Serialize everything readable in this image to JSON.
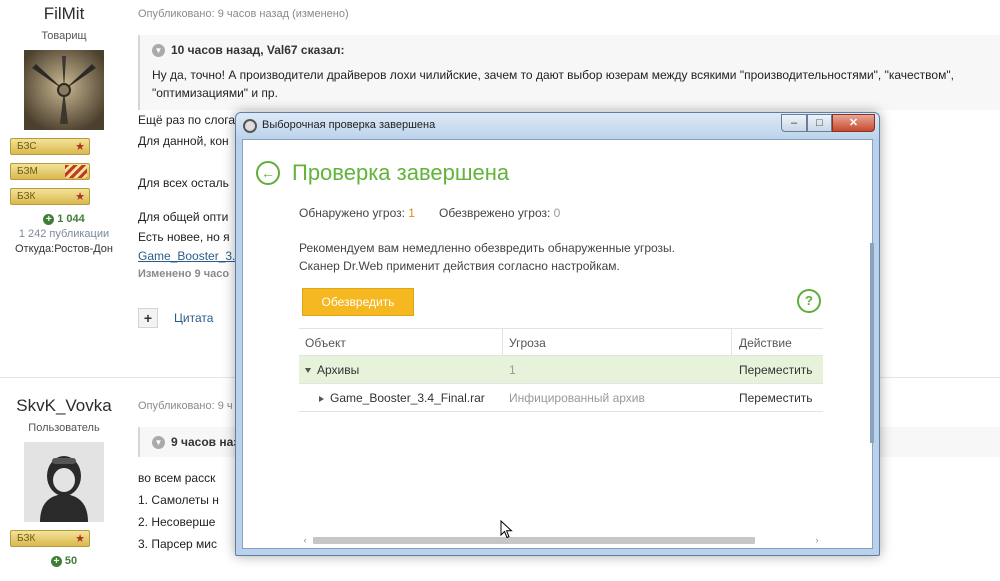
{
  "post1": {
    "author": {
      "name": "FilMit",
      "rank": "Товарищ",
      "badges": [
        {
          "label": "БЗС",
          "decoration": "star"
        },
        {
          "label": "БЗМ",
          "decoration": "stripes"
        },
        {
          "label": "БЗК",
          "decoration": "star"
        }
      ],
      "reputation": "1 044",
      "posts": "1 242 публикации",
      "location": "Откуда:Ростов-Дон"
    },
    "meta": "Опубликовано: 9 часов назад (изменено)",
    "quote": {
      "header": "10 часов назад, Val67 сказал:",
      "line1": "Ну да, точно! А производители драйверов лохи чилийские, зачем то дают выбор юзерам между всякими \"производительностями\", \"качеством\",",
      "line2": "\"оптимизациями\" и пр."
    },
    "lines": [
      "Ещё раз по слога",
      "Для данной, кон"
    ],
    "line3": "Для всех осталь",
    "line4": "Для общей опти",
    "line5": "Есть новее, но я",
    "link": "Game_Booster_3.",
    "edited": "Изменено 9 часо",
    "actions": {
      "plus": "+",
      "quote": "Цитата"
    }
  },
  "post2": {
    "author": {
      "name": "SkvK_Vovka",
      "rank": "Пользователь",
      "badges": [
        {
          "label": "БЗК",
          "decoration": "star"
        }
      ],
      "reputation": "50"
    },
    "meta": "Опубликовано: 9 ч",
    "quote": {
      "header": "9 часов наз"
    },
    "lines": [
      "во всем расск",
      "1. Самолеты н",
      "2. Несоверше",
      "3. Парсер мис"
    ]
  },
  "dialog": {
    "title": "Выборочная проверка завершена",
    "controls": {
      "minimize": "–",
      "maximize": "□",
      "close": "✕"
    },
    "heading": "Проверка завершена",
    "detected_label": "Обнаружено угроз:",
    "detected_value": "1",
    "neutralized_label": "Обезврежено угроз:",
    "neutralized_value": "0",
    "recommend_line1": "Рекомендуем вам немедленно обезвредить обнаруженные угрозы.",
    "recommend_line2": "Сканер Dr.Web применит действия согласно настройкам.",
    "neutralize_button": "Обезвредить",
    "help": "?",
    "table": {
      "columns": [
        "Объект",
        "Угроза",
        "Действие"
      ],
      "rows": [
        {
          "object": "Архивы",
          "threat": "1",
          "action": "Переместить",
          "expanded": true
        },
        {
          "object": "Game_Booster_3.4_Final.rar",
          "threat": "Инфицированный архив",
          "action": "Переместить",
          "expanded": false
        }
      ]
    }
  },
  "colors": {
    "accent_green": "#61b33a",
    "button_orange": "#f5b820",
    "threat_count_orange": "#e2891e",
    "selected_row": "#e6f2d9",
    "link_blue": "#2b5d8a"
  }
}
